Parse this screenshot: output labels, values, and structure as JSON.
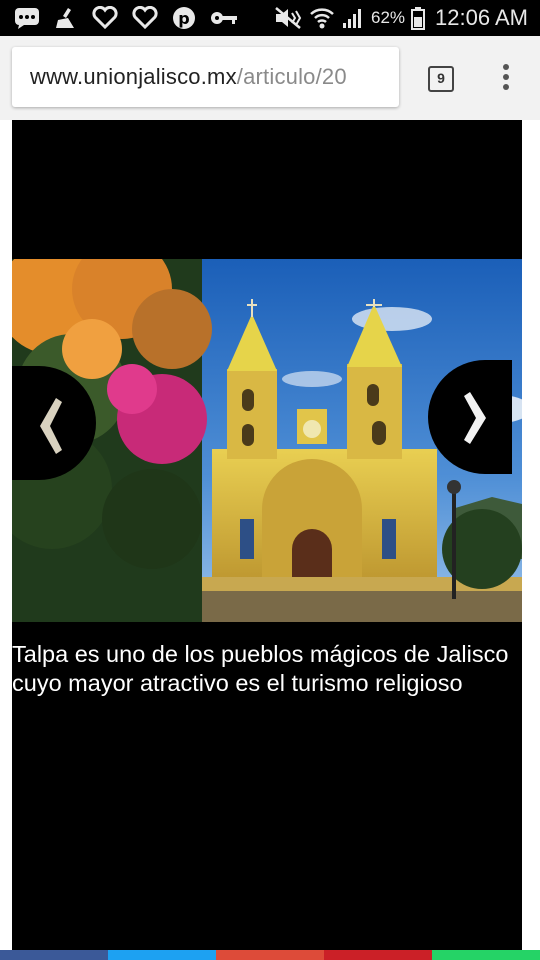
{
  "status_bar": {
    "battery": "62%",
    "time": "12:06 AM",
    "notification_icons": [
      "messenger-icon",
      "cleaner-icon",
      "heart-icon",
      "heart-icon",
      "pinterest-icon",
      "key-icon"
    ],
    "system_icons": [
      "mute-icon",
      "wifi-icon",
      "signal-icon",
      "battery-icon"
    ]
  },
  "browser": {
    "url_domain": "www.unionjalisco.mx",
    "url_path": "/articulo/20",
    "tab_count": "9"
  },
  "article": {
    "caption": "Talpa es uno de los pueblos mágicos de Jalisco cuyo mayor atractivo es el turismo religioso",
    "photo_subject": "Basílica de Talpa"
  },
  "share_bar": {
    "colors": [
      "#3b5998",
      "#1da1f2",
      "#dd4b39",
      "#cb2027",
      "#25d366"
    ]
  }
}
